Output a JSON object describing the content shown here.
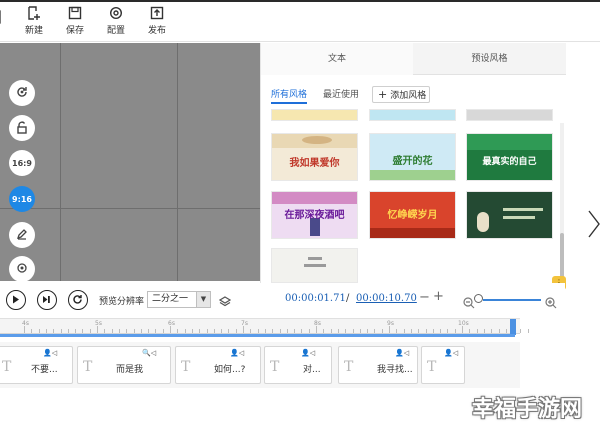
{
  "toolbar": {
    "new_label": "新建",
    "save_label": "保存",
    "config_label": "配置",
    "publish_label": "发布"
  },
  "canvas": {
    "aspect_16_9": "16:9",
    "aspect_9_16": "9:16",
    "selected_aspect": "9:16"
  },
  "panel": {
    "tabs": [
      "文本",
      "预设风格"
    ],
    "active_tab": "文本",
    "subtabs": [
      "所有风格",
      "最近使用"
    ],
    "active_subtab": "所有风格",
    "add_style_label": "添加风格",
    "thumbnails": [
      {
        "caption": "我如果爱你",
        "color": "#c0392b"
      },
      {
        "caption": "盛开的花",
        "color": "#2e7d32"
      },
      {
        "caption": "最真实的自己",
        "color": "#ffffff"
      },
      {
        "caption": "在那深夜酒吧",
        "color": "#6a1b9a"
      },
      {
        "caption": "忆峥嵘岁月",
        "color": "#ffd54f"
      },
      {
        "caption": "",
        "color": "#ffffff"
      },
      {
        "caption": "",
        "color": "#ffffff"
      }
    ]
  },
  "playback": {
    "ratio_label": "预览分辨率",
    "ratio_value": "二分之一",
    "current_time": "00:00:01.71",
    "separator": "/",
    "total_time": "00:00:10.70",
    "minus": "−",
    "plus": "+"
  },
  "ruler": {
    "labels": [
      "4s",
      "5s",
      "6s",
      "7s",
      "8s",
      "9s",
      "10s"
    ]
  },
  "track": {
    "clips": [
      {
        "text": "不要..."
      },
      {
        "text": "而是我"
      },
      {
        "text": "如何...?"
      },
      {
        "text": "对..."
      },
      {
        "text": "我寻找..."
      },
      {
        "text": ""
      }
    ]
  },
  "watermark": "幸福手游网",
  "colors": {
    "accent": "#1e88e5",
    "timecode": "#1a5fb4",
    "canvas_bg": "#8a8a8a"
  }
}
